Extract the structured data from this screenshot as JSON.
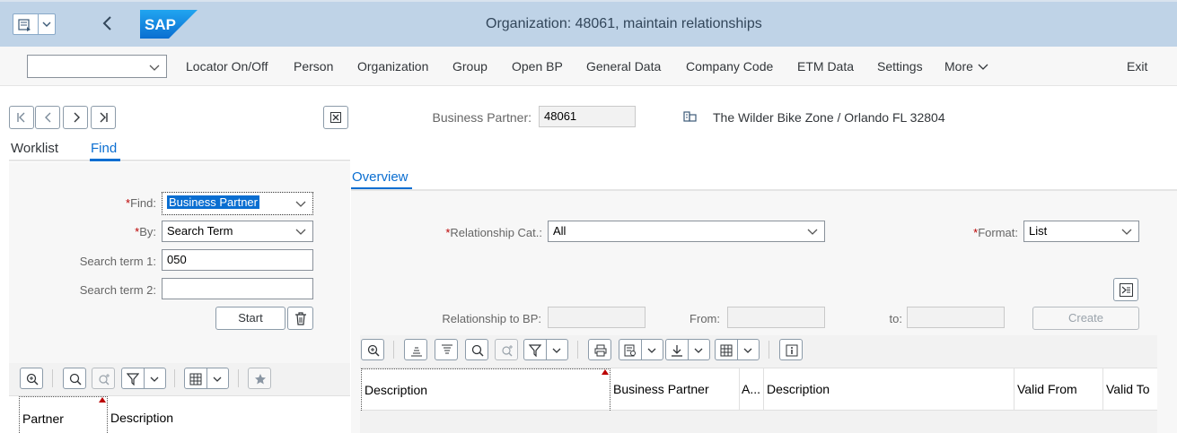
{
  "window": {
    "title": "Organization: 48061, maintain relationships"
  },
  "toolbar": {
    "command_value": "",
    "items": [
      "Locator On/Off",
      "Person",
      "Organization",
      "Group",
      "Open BP",
      "General Data",
      "Company Code",
      "ETM Data",
      "Settings"
    ],
    "more_label": "More",
    "exit_label": "Exit"
  },
  "locator": {
    "tabs": [
      "Worklist",
      "Find"
    ],
    "active_tab": "Find",
    "find_label": "Find:",
    "find_value": "Business Partner",
    "by_label": "By:",
    "by_value": "Search Term",
    "term1_label": "Search term 1:",
    "term1_value": "050",
    "term2_label": "Search term 2:",
    "term2_value": "",
    "start_label": "Start",
    "columns": [
      "Partner",
      "Description"
    ]
  },
  "header": {
    "bp_label": "Business Partner:",
    "bp_value": "48061",
    "bp_description": "The Wilder Bike Zone / Orlando FL 32804"
  },
  "overview": {
    "tab_label": "Overview",
    "rel_cat_label": "Relationship Cat.:",
    "rel_cat_value": "All",
    "format_label": "Format:",
    "format_value": "List",
    "rel_bp_label": "Relationship to BP:",
    "from_label": "From:",
    "to_label": "to:",
    "create_label": "Create",
    "columns": [
      "Description",
      "Business Partner",
      "A...",
      "Description",
      "Valid From",
      "Valid To"
    ]
  },
  "colors": {
    "shell": "#bfd3e7",
    "accent": "#0a6ed1",
    "required": "#bb0000"
  }
}
